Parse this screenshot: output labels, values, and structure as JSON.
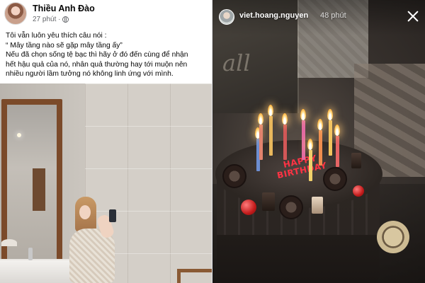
{
  "facebook_post": {
    "author": "Thiều Anh Đào",
    "time": "27 phút ·",
    "privacy_icon": "globe-icon",
    "lines": [
      "Tôi vẫn luôn yêu thích câu nói :",
      "“ Mây tầng nào sẽ gặp mây tầng ấy”",
      "Nếu đã chọn sống tệ bạc thì hãy ở đó đến cùng để nhận",
      "hết hậu quả của nó, nhân quả thường hay tới muộn nên",
      "nhiều người lầm tưởng nó không linh ứng với mình."
    ]
  },
  "instagram_story": {
    "username": "viet.hoang.nguyen",
    "time": "48 phút",
    "close_icon": "close-icon",
    "cake_text": [
      "HAPPY",
      "BIRTHDAY"
    ]
  },
  "colors": {
    "fb_text": "#050505",
    "fb_meta": "#65676b",
    "story_text": "#ffffff",
    "cake_writing": "#ff3344"
  }
}
